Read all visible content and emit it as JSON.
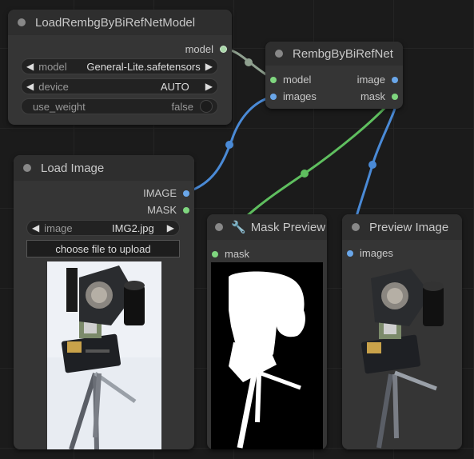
{
  "nodes": {
    "load_model": {
      "title": "LoadRembgByBiRefNetModel",
      "output_model": "model",
      "model_label": "model",
      "model_value": "General-Lite.safetensors",
      "device_label": "device",
      "device_value": "AUTO",
      "use_weight_label": "use_weight",
      "use_weight_value": "false"
    },
    "rembg": {
      "title": "RembgByBiRefNet",
      "input_model": "model",
      "input_images": "images",
      "output_image": "image",
      "output_mask": "mask"
    },
    "load_image": {
      "title": "Load Image",
      "output_image": "IMAGE",
      "output_mask": "MASK",
      "image_label": "image",
      "image_value": "IMG2.jpg",
      "upload_label": "choose file to upload"
    },
    "mask_preview": {
      "title": "Mask Preview",
      "icon": "wrench-icon",
      "input_mask": "mask"
    },
    "preview_image": {
      "title": "Preview Image",
      "input_images": "images"
    }
  },
  "colors": {
    "canvas": "#1b1b1b",
    "node_body": "#353535",
    "node_title": "#2e2e2e",
    "image_wire": "#6aa7ea",
    "mask_wire": "#7fd67f",
    "model_wire": "#a9c8a9"
  }
}
